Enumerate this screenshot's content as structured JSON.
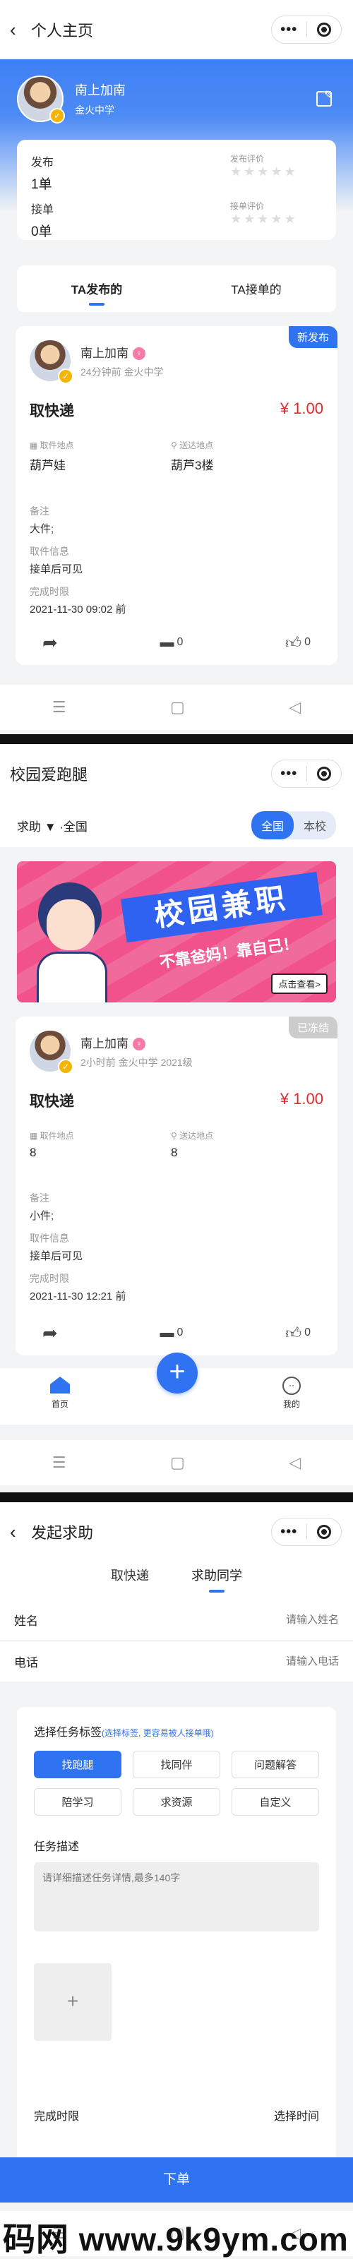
{
  "screen1": {
    "nav_title": "个人主页",
    "user": {
      "name": "南上加南",
      "school": "金火中学"
    },
    "stats": {
      "publish_label": "发布",
      "publish_value": "1单",
      "take_label": "接单",
      "take_value": "0单",
      "publish_rating_label": "发布评价",
      "take_rating_label": "接单评价",
      "stars": "★★★★★"
    },
    "tabs": [
      {
        "label": "TA发布的",
        "active": true
      },
      {
        "label": "TA接单的",
        "active": false
      }
    ],
    "card": {
      "tag": "新发布",
      "user": "南上加南",
      "meta": "24分钟前 金火中学",
      "title": "取快递",
      "price": "¥ 1.00",
      "pickup_label": "取件地点",
      "pickup_value": "葫芦娃",
      "dropoff_label": "送达地点",
      "dropoff_value": "葫芦3楼",
      "note_label": "备注",
      "note_value": "大件;",
      "info_label": "取件信息",
      "info_value": "接单后可见",
      "deadline_label": "完成时限",
      "deadline_value": "2021-11-30 09:02 前",
      "comments": "0",
      "likes": "0"
    }
  },
  "screen2": {
    "nav_title": "校园爱跑腿",
    "filter": "求助 ▼ ·全国",
    "seg": [
      {
        "label": "全国",
        "active": true
      },
      {
        "label": "本校",
        "active": false
      }
    ],
    "banner": {
      "title": "校园兼职",
      "sub": "不靠爸妈！靠自己！",
      "btn": "点击查看>"
    },
    "card": {
      "tag": "已冻结",
      "user": "南上加南",
      "meta": "2小时前 金火中学 2021级",
      "title": "取快递",
      "price": "¥ 1.00",
      "pickup_label": "取件地点",
      "pickup_value": "8",
      "dropoff_label": "送达地点",
      "dropoff_value": "8",
      "note_label": "备注",
      "note_value": "小件;",
      "info_label": "取件信息",
      "info_value": "接单后可见",
      "deadline_label": "完成时限",
      "deadline_value": "2021-11-30 12:21 前",
      "comments": "0",
      "likes": "0"
    },
    "tabbar": {
      "home": "首页",
      "mine": "我的",
      "fab": "+"
    }
  },
  "screen3": {
    "nav_title": "发起求助",
    "tabs": [
      {
        "label": "取快递",
        "active": false
      },
      {
        "label": "求助同学",
        "active": true
      }
    ],
    "name_label": "姓名",
    "name_placeholder": "请输入姓名",
    "phone_label": "电话",
    "phone_placeholder": "请输入电话",
    "tag_title": "选择任务标签",
    "tag_hint": "(选择标签, 更容易被人接单哦)",
    "chips": [
      {
        "label": "找跑腿",
        "active": true
      },
      {
        "label": "找同伴",
        "active": false
      },
      {
        "label": "问题解答",
        "active": false
      },
      {
        "label": "陪学习",
        "active": false
      },
      {
        "label": "求资源",
        "active": false
      },
      {
        "label": "自定义",
        "active": false
      }
    ],
    "desc_label": "任务描述",
    "desc_placeholder": "请详细描述任务详情,最多140字",
    "upload": "+",
    "deadline_label": "完成时限",
    "deadline_value": "选择时间",
    "submit": "下单"
  },
  "watermark": "码网 www.9k9ym.com",
  "colors": {
    "accent": "#2f73f2",
    "price": "#e02a2a",
    "frozen": "#cccccc"
  }
}
